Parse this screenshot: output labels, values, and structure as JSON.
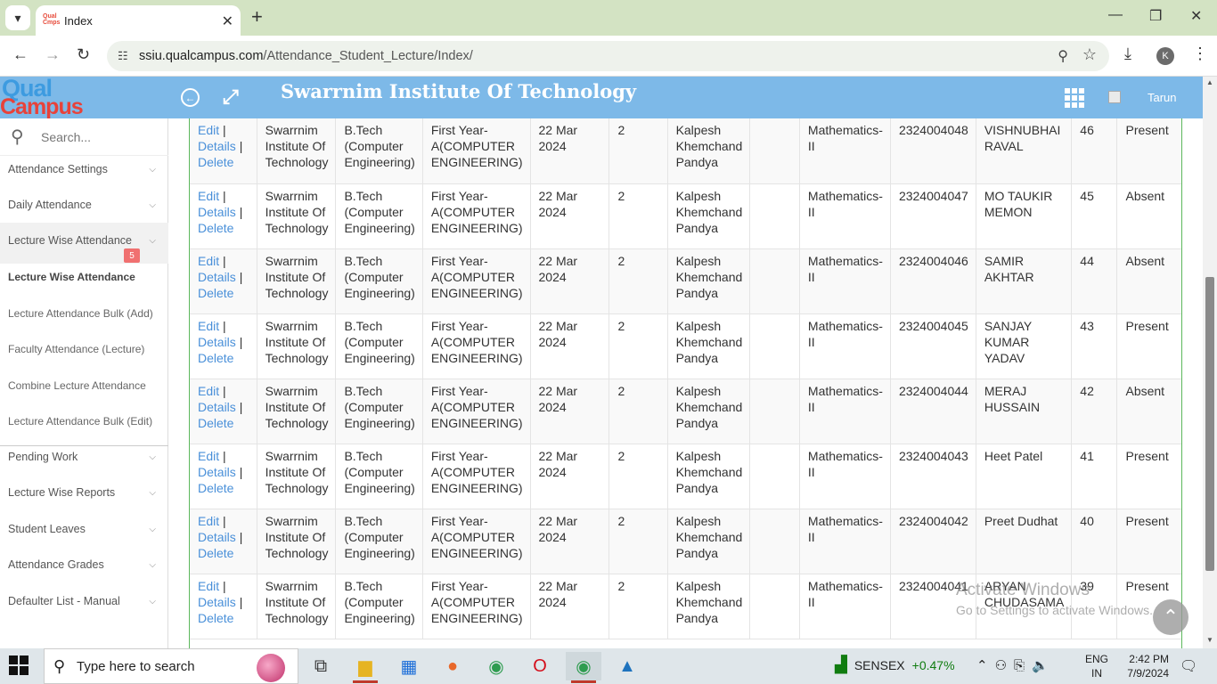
{
  "browser": {
    "tab_title": "Index",
    "tab_favicon": "QualCampus",
    "url_domain": "ssiu.qualcampus.com",
    "url_path": "/Attendance_Student_Lecture/Index/",
    "profile_initial": "K"
  },
  "header": {
    "logo_top": "Qual",
    "logo_bottom": "Campus",
    "title": "Swarrnim Institute Of Technology",
    "user_name": "Tarun"
  },
  "sidebar": {
    "search_placeholder": "Search...",
    "items": [
      {
        "label": "Attendance Settings"
      },
      {
        "label": "Daily Attendance"
      },
      {
        "label": "Lecture Wise Attendance",
        "badge": "5"
      },
      {
        "label": "Lecture Wise Attendance"
      },
      {
        "label": "Lecture Attendance Bulk (Add)"
      },
      {
        "label": "Faculty Attendance (Lecture)"
      },
      {
        "label": "Combine Lecture Attendance"
      },
      {
        "label": "Lecture Attendance Bulk (Edit)"
      },
      {
        "label": "Pending Work"
      },
      {
        "label": "Lecture Wise Reports"
      },
      {
        "label": "Student Leaves"
      },
      {
        "label": "Attendance Grades"
      },
      {
        "label": "Defaulter List - Manual"
      }
    ]
  },
  "table": {
    "action_labels": {
      "edit": "Edit",
      "details": "Details",
      "delete": "Delete",
      "separator": "|"
    },
    "rows": [
      {
        "institute": "Swarrnim Institute Of Technology",
        "course": "B.Tech (Computer Engineering)",
        "division": "First Year-A(COMPUTER ENGINEERING)",
        "date": "22 Mar 2024",
        "lecture": "2",
        "faculty": "Kalpesh Khemchand Pandya",
        "extra": "",
        "subject": "Mathematics-II",
        "enrollment": "2324004048",
        "student": "VISHNUBHAI RAVAL",
        "roll": "46",
        "status": "Present"
      },
      {
        "institute": "Swarrnim Institute Of Technology",
        "course": "B.Tech (Computer Engineering)",
        "division": "First Year-A(COMPUTER ENGINEERING)",
        "date": "22 Mar 2024",
        "lecture": "2",
        "faculty": "Kalpesh Khemchand Pandya",
        "extra": "",
        "subject": "Mathematics-II",
        "enrollment": "2324004047",
        "student": "MO TAUKIR MEMON",
        "roll": "45",
        "status": "Absent"
      },
      {
        "institute": "Swarrnim Institute Of Technology",
        "course": "B.Tech (Computer Engineering)",
        "division": "First Year-A(COMPUTER ENGINEERING)",
        "date": "22 Mar 2024",
        "lecture": "2",
        "faculty": "Kalpesh Khemchand Pandya",
        "extra": "",
        "subject": "Mathematics-II",
        "enrollment": "2324004046",
        "student": "SAMIR AKHTAR",
        "roll": "44",
        "status": "Absent"
      },
      {
        "institute": "Swarrnim Institute Of Technology",
        "course": "B.Tech (Computer Engineering)",
        "division": "First Year-A(COMPUTER ENGINEERING)",
        "date": "22 Mar 2024",
        "lecture": "2",
        "faculty": "Kalpesh Khemchand Pandya",
        "extra": "",
        "subject": "Mathematics-II",
        "enrollment": "2324004045",
        "student": "SANJAY KUMAR YADAV",
        "roll": "43",
        "status": "Present"
      },
      {
        "institute": "Swarrnim Institute Of Technology",
        "course": "B.Tech (Computer Engineering)",
        "division": "First Year-A(COMPUTER ENGINEERING)",
        "date": "22 Mar 2024",
        "lecture": "2",
        "faculty": "Kalpesh Khemchand Pandya",
        "extra": "",
        "subject": "Mathematics-II",
        "enrollment": "2324004044",
        "student": "MERAJ HUSSAIN",
        "roll": "42",
        "status": "Absent"
      },
      {
        "institute": "Swarrnim Institute Of Technology",
        "course": "B.Tech (Computer Engineering)",
        "division": "First Year-A(COMPUTER ENGINEERING)",
        "date": "22 Mar 2024",
        "lecture": "2",
        "faculty": "Kalpesh Khemchand Pandya",
        "extra": "",
        "subject": "Mathematics-II",
        "enrollment": "2324004043",
        "student": "Heet Patel",
        "roll": "41",
        "status": "Present"
      },
      {
        "institute": "Swarrnim Institute Of Technology",
        "course": "B.Tech (Computer Engineering)",
        "division": "First Year-A(COMPUTER ENGINEERING)",
        "date": "22 Mar 2024",
        "lecture": "2",
        "faculty": "Kalpesh Khemchand Pandya",
        "extra": "",
        "subject": "Mathematics-II",
        "enrollment": "2324004042",
        "student": "Preet Dudhat",
        "roll": "40",
        "status": "Present"
      },
      {
        "institute": "Swarrnim Institute Of Technology",
        "course": "B.Tech (Computer Engineering)",
        "division": "First Year-A(COMPUTER ENGINEERING)",
        "date": "22 Mar 2024",
        "lecture": "2",
        "faculty": "Kalpesh Khemchand Pandya",
        "extra": "",
        "subject": "Mathematics-II",
        "enrollment": "2324004041",
        "student": "ARYAN CHUDASAMA",
        "roll": "39",
        "status": "Present"
      }
    ]
  },
  "watermark": {
    "title": "Activate Windows",
    "subtitle": "Go to Settings to activate Windows."
  },
  "taskbar": {
    "search_placeholder": "Type here to search",
    "sensex_label": "SENSEX",
    "sensex_change": "+0.47%",
    "lang_top": "ENG",
    "lang_bottom": "IN",
    "time": "2:42 PM",
    "date": "7/9/2024"
  }
}
